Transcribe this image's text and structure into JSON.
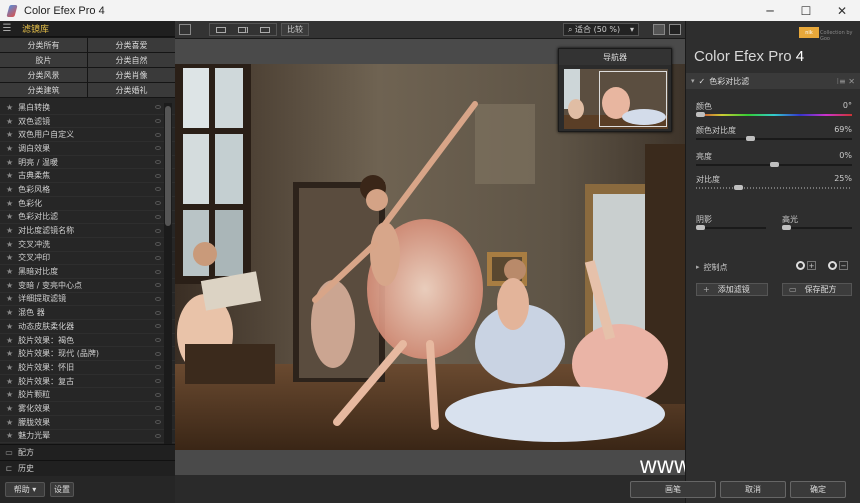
{
  "window": {
    "title": "Color Efex Pro 4",
    "controls": [
      "─",
      "☐",
      "✕"
    ]
  },
  "left_panel": {
    "header_title": "滤镜库",
    "categories": [
      "分类所有",
      "分类喜爱",
      "胶片",
      "分类自然",
      "分类风景",
      "分类肖像",
      "分类建筑",
      "分类婚礼"
    ],
    "filters": [
      "黑白转换",
      "双色滤镜",
      "双色用户自定义",
      "调白效果",
      "明亮 / 温暖",
      "古典柔焦",
      "色彩风格",
      "色彩化",
      "色彩对比滤",
      "对比度滤镜名称",
      "交叉冲洗",
      "交叉冲印",
      "黑暗对比度",
      "变暗 / 变亮中心点",
      "详细提取滤镜",
      "混色 器",
      "动态皮肤柔化器",
      "胶片效果：褐色",
      "胶片效果：现代 (品牌)",
      "胶片效果：怀旧",
      "胶片效果：复古",
      "胶片颗粒",
      "雾化效果",
      "朦胧效果",
      "魅力光晕"
    ],
    "footer_recipes": "配方",
    "footer_history": "历史",
    "help_button": "帮助",
    "settings_button": "设置"
  },
  "toolbar": {
    "compare_button": "比较",
    "zoom_value": "适合 (50 %)"
  },
  "navigator": {
    "title": "导航器"
  },
  "watermark": "www.hunls.com",
  "right_panel": {
    "brand_badge": "nik",
    "brand_sub": "Collection by Goo",
    "product_name": "Color Efex Pro",
    "product_version": "4",
    "active_filter": "色彩对比滤",
    "filter_icons": "⁝≡ ✕",
    "sliders": [
      {
        "label": "颜色",
        "value": "0°"
      },
      {
        "label": "颜色对比度",
        "value": "69%"
      },
      {
        "label": "亮度",
        "value": "0%"
      },
      {
        "label": "对比度",
        "value": "25%"
      }
    ],
    "shadows_label": "阴影",
    "highlights_label": "高光",
    "control_points_label": "控制点",
    "add_filter_button": "添加滤镜",
    "save_recipe_button": "保存配方",
    "brush_button": "画笔",
    "cancel_button": "取消",
    "ok_button": "确定"
  }
}
